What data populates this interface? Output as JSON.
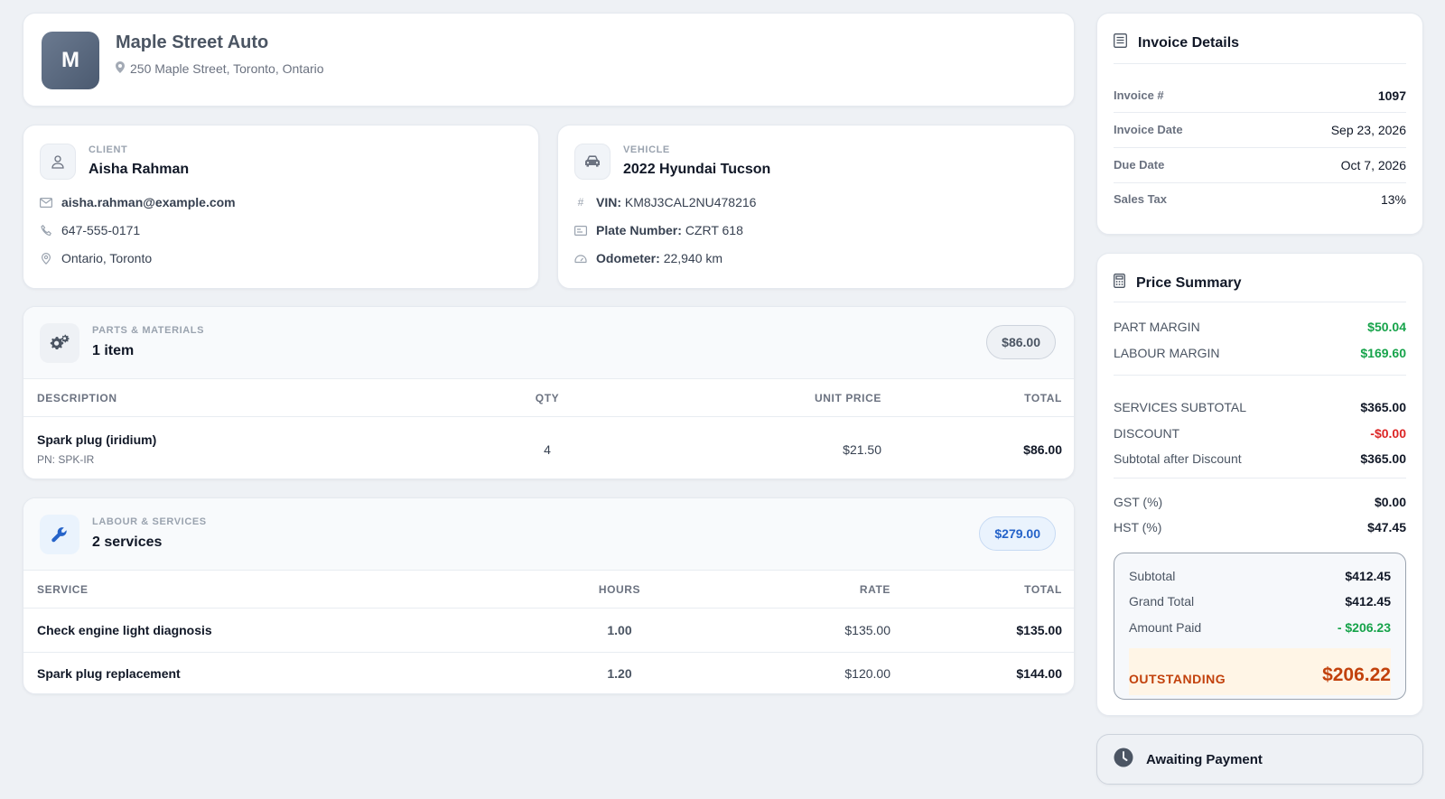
{
  "shop": {
    "logo_letter": "M",
    "name": "Maple Street Auto",
    "address": "250 Maple Street, Toronto, Ontario"
  },
  "client": {
    "kicker": "CLIENT",
    "name": "Aisha Rahman",
    "email": "aisha.rahman@example.com",
    "phone": "647-555-0171",
    "location": "Ontario, Toronto"
  },
  "vehicle": {
    "kicker": "VEHICLE",
    "title": "2022 Hyundai Tucson",
    "vin_label": "VIN:",
    "vin": "KM8J3CAL2NU478216",
    "plate_label": "Plate Number:",
    "plate": "CZRT 618",
    "odometer_label": "Odometer:",
    "odometer": "22,940 km"
  },
  "parts": {
    "kicker": "PARTS & MATERIALS",
    "title": "1 item",
    "total_pill": "$86.00",
    "columns": [
      "DESCRIPTION",
      "QTY",
      "UNIT PRICE",
      "TOTAL"
    ],
    "rows": [
      {
        "description": "Spark plug (iridium)",
        "pn": "PN: SPK-IR",
        "qty": "4",
        "unit_price": "$21.50",
        "total": "$86.00"
      }
    ]
  },
  "labour": {
    "kicker": "LABOUR & SERVICES",
    "title": "2 services",
    "total_pill": "$279.00",
    "columns": [
      "SERVICE",
      "HOURS",
      "RATE",
      "TOTAL"
    ],
    "rows": [
      {
        "service": "Check engine light diagnosis",
        "hours": "1.00",
        "rate": "$135.00",
        "total": "$135.00"
      },
      {
        "service": "Spark plug replacement",
        "hours": "1.20",
        "rate": "$120.00",
        "total": "$144.00"
      }
    ]
  },
  "invoice": {
    "title": "Invoice Details",
    "number_label": "Invoice #",
    "number": "1097",
    "date_label": "Invoice Date",
    "date": "Sep 23, 2026",
    "due_label": "Due Date",
    "due": "Oct 7, 2026",
    "tax_label": "Sales Tax",
    "tax": "13%"
  },
  "price": {
    "title": "Price Summary",
    "part_margin_label": "PART MARGIN",
    "part_margin": "$50.04",
    "labour_margin_label": "LABOUR MARGIN",
    "labour_margin": "$169.60",
    "services_subtotal_label": "SERVICES SUBTOTAL",
    "services_subtotal": "$365.00",
    "discount_label": "DISCOUNT",
    "discount": "-$0.00",
    "after_discount_label": "Subtotal after Discount",
    "after_discount": "$365.00",
    "gst_label": "GST (%)",
    "gst": "$0.00",
    "hst_label": "HST (%)",
    "hst": "$47.45",
    "subtotal_label": "Subtotal",
    "subtotal": "$412.45",
    "grand_total_label": "Grand Total",
    "grand_total": "$412.45",
    "paid_label": "Amount Paid",
    "paid": "- $206.23",
    "outstanding_label": "OUTSTANDING",
    "outstanding": "$206.22"
  },
  "status": {
    "label": "Awaiting Payment"
  },
  "colors": {
    "green": "#16a34a",
    "red": "#dc2626",
    "orange": "#c2410c",
    "blue": "#2563c9"
  }
}
